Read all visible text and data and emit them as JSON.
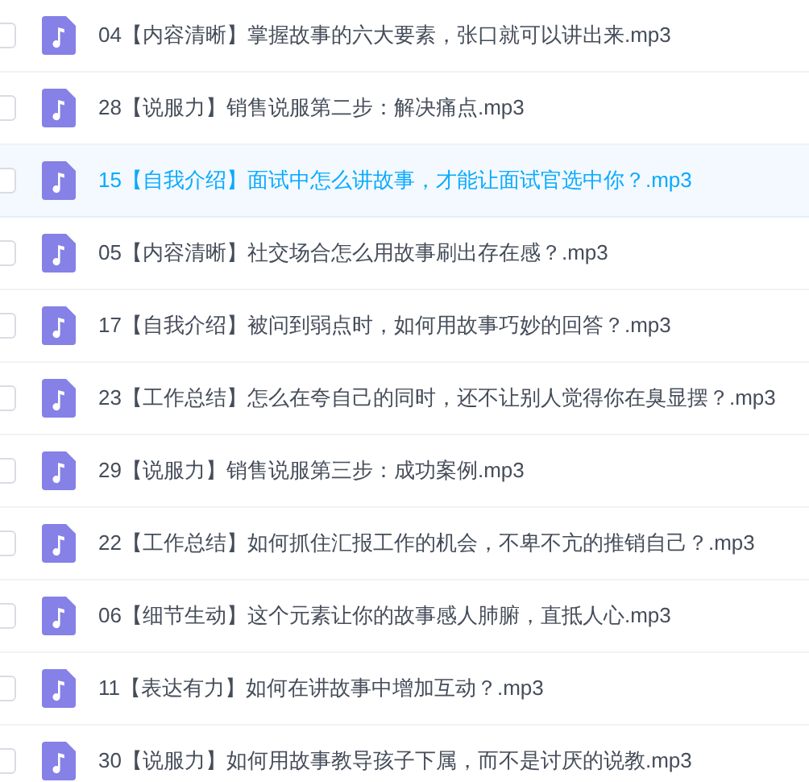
{
  "files": [
    {
      "name": "04【内容清晰】掌握故事的六大要素，张口就可以讲出来.mp3",
      "selected": false,
      "checked": false
    },
    {
      "name": "28【说服力】销售说服第二步：解决痛点.mp3",
      "selected": false,
      "checked": false
    },
    {
      "name": "15【自我介绍】面试中怎么讲故事，才能让面试官选中你？.mp3",
      "selected": true,
      "checked": false
    },
    {
      "name": "05【内容清晰】社交场合怎么用故事刷出存在感？.mp3",
      "selected": false,
      "checked": false
    },
    {
      "name": "17【自我介绍】被问到弱点时，如何用故事巧妙的回答？.mp3",
      "selected": false,
      "checked": false
    },
    {
      "name": "23【工作总结】怎么在夸自己的同时，还不让别人觉得你在臭显摆？.mp3",
      "selected": false,
      "checked": false
    },
    {
      "name": "29【说服力】销售说服第三步：成功案例.mp3",
      "selected": false,
      "checked": false
    },
    {
      "name": "22【工作总结】如何抓住汇报工作的机会，不卑不亢的推销自己？.mp3",
      "selected": false,
      "checked": false
    },
    {
      "name": "06【细节生动】这个元素让你的故事感人肺腑，直抵人心.mp3",
      "selected": false,
      "checked": false
    },
    {
      "name": "11【表达有力】如何在讲故事中增加互动？.mp3",
      "selected": false,
      "checked": false
    },
    {
      "name": "30【说服力】如何用故事教导孩子下属，而不是讨厌的说教.mp3",
      "selected": false,
      "checked": false
    }
  ]
}
